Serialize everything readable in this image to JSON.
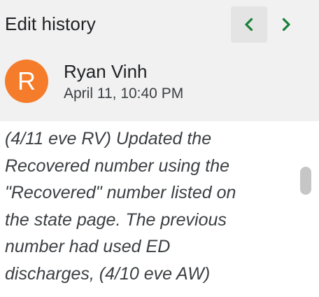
{
  "header": {
    "title": "Edit history",
    "prev_icon": "chevron-left-icon",
    "next_icon": "chevron-right-icon",
    "nav_color": "#188038"
  },
  "revision": {
    "avatar_letter": "R",
    "avatar_color": "#f57c2b",
    "user_name": "Ryan Vinh",
    "timestamp": "April 11, 10:40 PM"
  },
  "content": {
    "lines": [
      "(4/11 eve RV) Updated the",
      "Recovered number using the",
      "\"Recovered\" number listed on",
      "the state page. The previous",
      "number had used ED",
      "discharges, (4/10 eve AW)"
    ]
  }
}
